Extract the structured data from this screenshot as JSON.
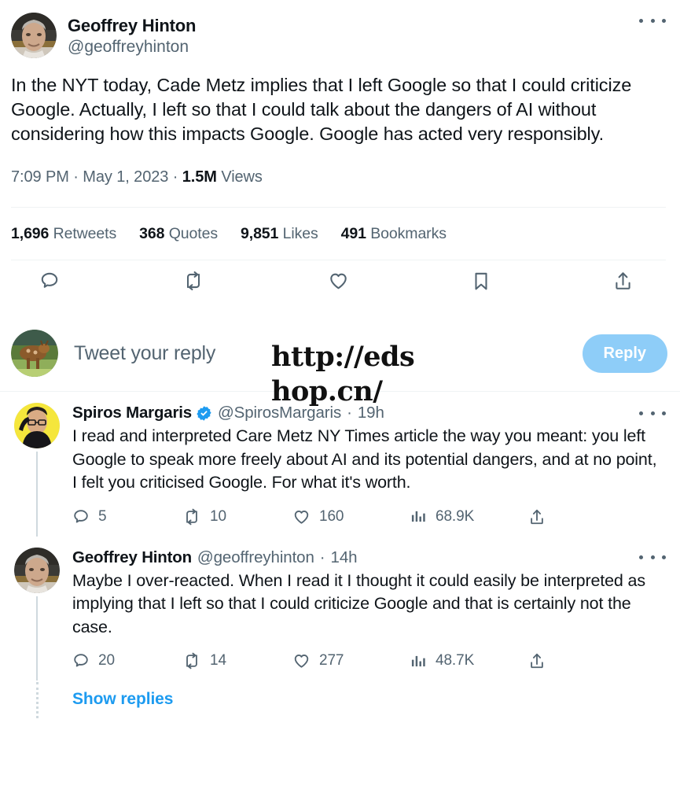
{
  "main_tweet": {
    "author_name": "Geoffrey Hinton",
    "author_handle": "@geoffreyhinton",
    "avatar_icon": "geoffrey-hinton-avatar-photo",
    "more_icon": "more-options-icon",
    "body": "In the NYT today, Cade Metz implies that I left Google so that I could criticize Google. Actually, I left so that I could talk about the dangers of AI without considering how this impacts Google. Google has acted very responsibly.",
    "meta": {
      "time": "7:09 PM",
      "sep1": "·",
      "date": "May 1, 2023",
      "sep2": "·",
      "views_count": "1.5M",
      "views_label": "Views"
    },
    "stats": [
      {
        "count": "1,696",
        "label": "Retweets"
      },
      {
        "count": "368",
        "label": "Quotes"
      },
      {
        "count": "9,851",
        "label": "Likes"
      },
      {
        "count": "491",
        "label": "Bookmarks"
      }
    ],
    "actions": [
      {
        "icon": "reply-icon",
        "name": "reply-action"
      },
      {
        "icon": "retweet-icon",
        "name": "retweet-action"
      },
      {
        "icon": "like-heart-icon",
        "name": "like-action"
      },
      {
        "icon": "bookmark-icon",
        "name": "bookmark-action"
      },
      {
        "icon": "share-icon",
        "name": "share-action"
      }
    ]
  },
  "composer": {
    "avatar_icon": "current-user-deer-avatar-photo",
    "placeholder": "Tweet your reply",
    "reply_button_label": "Reply",
    "reply_button_color": "#8ecdf8"
  },
  "replies": [
    {
      "author_name": "Spiros Margaris",
      "verified": true,
      "verified_icon": "verified-badge-icon",
      "handle": "@SpirosMargaris",
      "separator": "·",
      "timestamp": "19h",
      "avatar_icon": "spiros-margaris-avatar-photo",
      "more_icon": "more-options-icon",
      "body": "I read and interpreted Care Metz NY Times article the way you meant: you left Google to speak more freely about AI and its potential dangers, and at no point, I felt you criticised Google. For what it's worth.",
      "metrics": {
        "replies": "5",
        "retweets": "10",
        "likes": "160",
        "views": "68.9K"
      }
    },
    {
      "author_name": "Geoffrey Hinton",
      "verified": false,
      "verified_icon": "",
      "handle": "@geoffreyhinton",
      "separator": "·",
      "timestamp": "14h",
      "avatar_icon": "geoffrey-hinton-avatar-photo",
      "more_icon": "more-options-icon",
      "body": "Maybe I over-reacted. When I read it I thought it could easily be interpreted as implying that I left so that I could criticize Google and that is certainly not the case.",
      "metrics": {
        "replies": "20",
        "retweets": "14",
        "likes": "277",
        "views": "48.7K"
      }
    }
  ],
  "show_replies": {
    "label": "Show replies",
    "link_color": "#1d9bf0"
  },
  "watermark": {
    "line1": "http://eds",
    "line2": "hop.cn/"
  },
  "colors": {
    "text": "#0f1419",
    "muted": "#536471",
    "divider": "#eff3f4",
    "accent": "#1d9bf0",
    "thread_line": "#cfd9de"
  }
}
